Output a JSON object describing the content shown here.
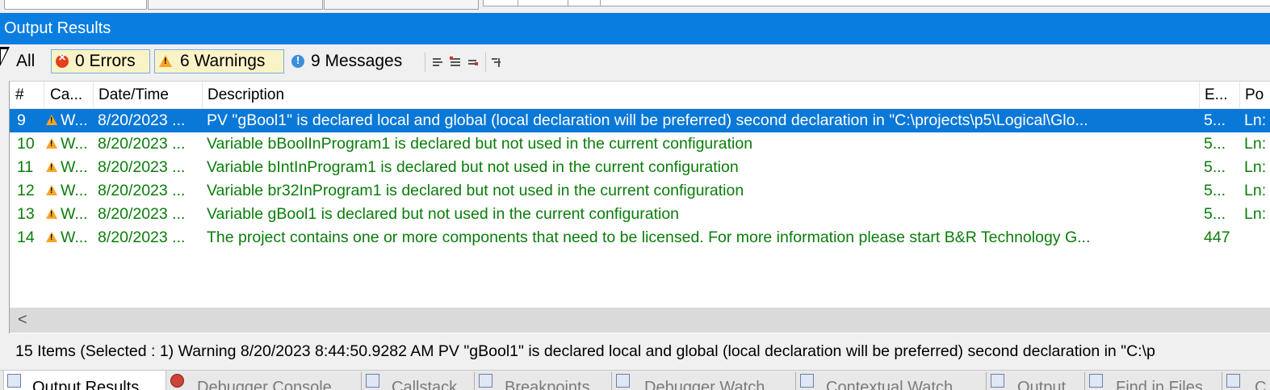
{
  "window": {
    "title": "Output Results"
  },
  "filters": {
    "all": "All",
    "errors": "0 Errors",
    "warnings": "6 Warnings",
    "messages": "9 Messages"
  },
  "grid": {
    "columns": [
      "#",
      "Ca...",
      "Date/Time",
      "Description",
      "E...",
      "Po"
    ],
    "rows": [
      {
        "num": "9",
        "cat": "W...",
        "date": "8/20/2023 ...",
        "desc": "PV \"gBool1\" is declared local and global (local declaration will be preferred) second declaration in \"C:\\projects\\p5\\Logical\\Glo...",
        "e": "5...",
        "pos": "Ln:"
      },
      {
        "num": "10",
        "cat": "W...",
        "date": "8/20/2023 ...",
        "desc": "Variable bBoolInProgram1 is declared but not used in the current configuration",
        "e": "5...",
        "pos": "Ln:"
      },
      {
        "num": "11",
        "cat": "W...",
        "date": "8/20/2023 ...",
        "desc": "Variable bIntInProgram1 is declared but not used in the current configuration",
        "e": "5...",
        "pos": "Ln:"
      },
      {
        "num": "12",
        "cat": "W...",
        "date": "8/20/2023 ...",
        "desc": "Variable br32InProgram1 is declared but not used in the current configuration",
        "e": "5...",
        "pos": "Ln:"
      },
      {
        "num": "13",
        "cat": "W...",
        "date": "8/20/2023 ...",
        "desc": "Variable gBool1 is declared but not used in the current configuration",
        "e": "5...",
        "pos": "Ln:"
      },
      {
        "num": "14",
        "cat": "W...",
        "date": "8/20/2023 ...",
        "desc": "The project contains one or more components that need to be licensed. For more information please start B&R Technology G...",
        "e": "447",
        "pos": ""
      }
    ],
    "scroll_left": "<"
  },
  "status": {
    "text": "15 Items (Selected : 1) Warning 8/20/2023 8:44:50.9282 AM PV \"gBool1\" is declared local and global (local declaration will be preferred) second declaration in \"C:\\p"
  },
  "bottom_tabs": [
    {
      "label": "Output Results",
      "icon": "output-results-icon",
      "active": true
    },
    {
      "label": "Debugger Console",
      "icon": "bug-icon"
    },
    {
      "label": "Callstack",
      "icon": "callstack-icon"
    },
    {
      "label": "Breakpoints",
      "icon": "breakpoints-icon"
    },
    {
      "label": "Debugger Watch",
      "icon": "watch-icon"
    },
    {
      "label": "Contextual Watch",
      "icon": "contextual-watch-icon"
    },
    {
      "label": "Output",
      "icon": "output-icon"
    },
    {
      "label": "Find in Files",
      "icon": "find-in-files-icon"
    },
    {
      "label": "C",
      "icon": "document-icon"
    }
  ],
  "colors": {
    "title_bar": "#0a7ee0",
    "selected_row": "#0a78d7",
    "warning_text": "#0a7d0a",
    "active_filter_bg": "#fbf3c8"
  }
}
